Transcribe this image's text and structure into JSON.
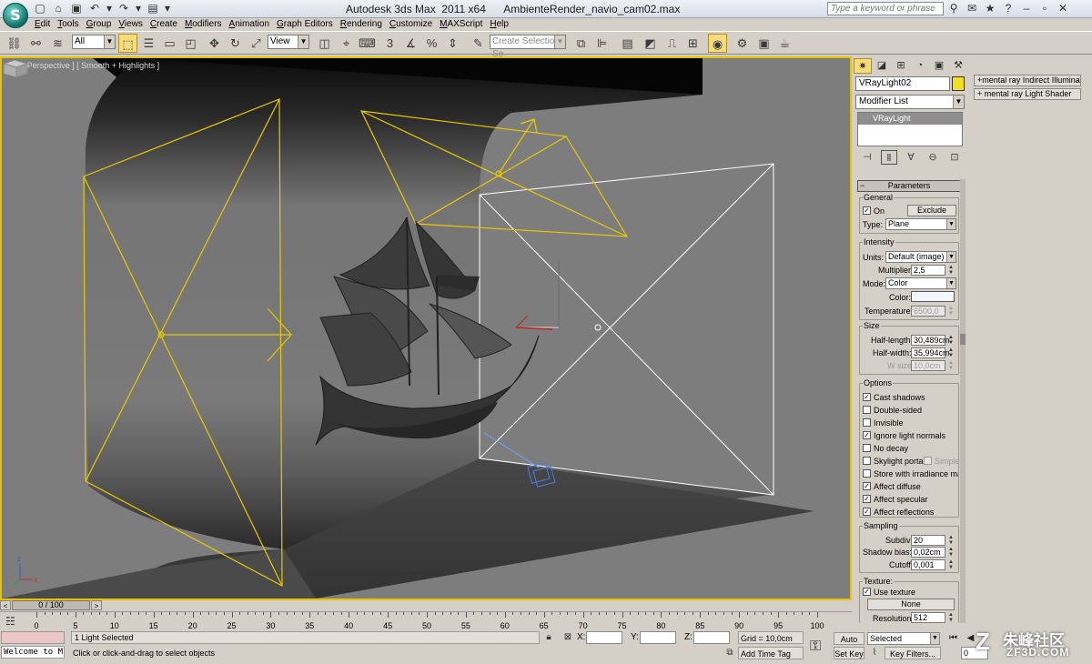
{
  "window": {
    "title": "Autodesk 3ds Max  2011 x64      AmbienteRender_navio_cam02.max",
    "search_placeholder": "Type a keyword or phrase"
  },
  "menu": [
    "Edit",
    "Tools",
    "Group",
    "Views",
    "Create",
    "Modifiers",
    "Animation",
    "Graph Editors",
    "Rendering",
    "Customize",
    "MAXScript",
    "Help"
  ],
  "toolbar": {
    "filter_value": "All",
    "coord_system": "View",
    "named_selection_placeholder": "Create Selection Se"
  },
  "viewport": {
    "label": "[ + ] [ Perspective ] [ Smooth + Highlights ]"
  },
  "command_panel": {
    "object_name": "VRayLight02",
    "modifier_list": "Modifier List",
    "stack_item": "VRayLight",
    "rollout_title": "Parameters",
    "general": {
      "label": "General",
      "on_label": "On",
      "on_checked": true,
      "exclude_button": "Exclude",
      "type_label": "Type:",
      "type_value": "Plane"
    },
    "intensity": {
      "label": "Intensity",
      "units_label": "Units:",
      "units_value": "Default (image)",
      "multiplier_label": "Multiplier:",
      "multiplier_value": "2,5",
      "mode_label": "Mode:",
      "mode_value": "Color",
      "color_label": "Color:",
      "temperature_label": "Temperature:",
      "temperature_value": "6500,0"
    },
    "size": {
      "label": "Size",
      "half_length_label": "Half-length:",
      "half_length_value": "30,489cm",
      "half_width_label": "Half-width:",
      "half_width_value": "35,994cm",
      "w_size_label": "W size",
      "w_size_value": "10,0cm"
    },
    "options": {
      "label": "Options",
      "items": [
        {
          "label": "Cast shadows",
          "checked": true
        },
        {
          "label": "Double-sided",
          "checked": false
        },
        {
          "label": "Invisible",
          "checked": false
        },
        {
          "label": "Ignore light normals",
          "checked": true
        },
        {
          "label": "No decay",
          "checked": false
        },
        {
          "label": "Skylight portal",
          "checked": false
        },
        {
          "label": "Store with irradiance map",
          "checked": false
        },
        {
          "label": "Affect diffuse",
          "checked": true
        },
        {
          "label": "Affect specular",
          "checked": true
        },
        {
          "label": "Affect reflections",
          "checked": true
        }
      ],
      "simple_label": "Simple"
    },
    "sampling": {
      "label": "Sampling",
      "subdivs_label": "Subdivs:",
      "subdivs_value": "20",
      "shadow_bias_label": "Shadow bias:",
      "shadow_bias_value": "0,02cm",
      "cutoff_label": "Cutoff:",
      "cutoff_value": "0,001"
    },
    "texture": {
      "label": "Texture:",
      "use_texture_label": "Use texture",
      "use_texture_checked": true,
      "none_button": "None",
      "resolution_label": "Resolution:",
      "resolution_value": "512"
    }
  },
  "mental_ray": {
    "items": [
      "mental ray Indirect Illumination",
      "mental ray Light Shader"
    ]
  },
  "timeline": {
    "frame_display": "0 / 100",
    "ticks": [
      "0",
      "5",
      "10",
      "15",
      "20",
      "25",
      "30",
      "35",
      "40",
      "45",
      "50",
      "55",
      "60",
      "65",
      "70",
      "75",
      "80",
      "85",
      "90",
      "95",
      "100"
    ]
  },
  "status": {
    "maxscript_listener": "Welcome to M",
    "selection_count": "1 Light Selected",
    "prompt": "Click or click-and-drag to select objects",
    "x_label": "X:",
    "y_label": "Y:",
    "z_label": "Z:",
    "grid": "Grid = 10,0cm",
    "add_time_tag": "Add Time Tag",
    "auto_key": "Auto Key",
    "set_key": "Set Key",
    "key_mode": "Selected",
    "key_filters": "Key Filters...",
    "current_frame": "0"
  },
  "watermark": {
    "text": "朱峰社区",
    "sub": "ZF3D.COM"
  },
  "accent_colors": {
    "viewport_border": "#e8c400",
    "active_button": "#f7dc7c",
    "light_wire": "#f0d020"
  }
}
